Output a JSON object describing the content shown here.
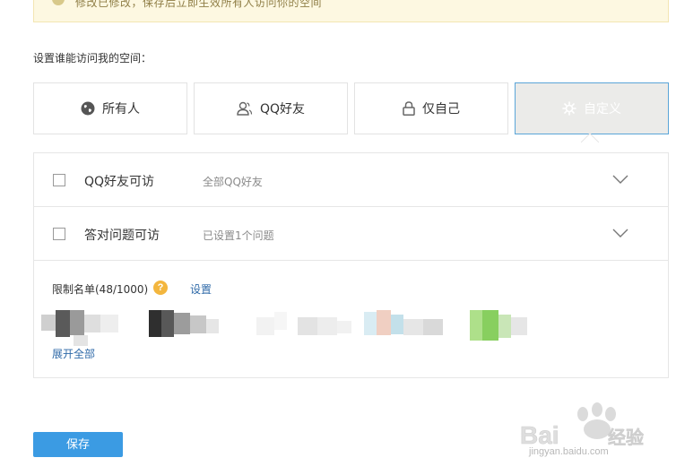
{
  "notice": {
    "text": "修改已修改，保存后立即生效所有人访问你的空间",
    "icon": "info-icon"
  },
  "section_label": "设置谁能访问我的空间：",
  "options": [
    {
      "label": "所有人",
      "icon": "globe-icon",
      "selected": false
    },
    {
      "label": "QQ好友",
      "icon": "friends-icon",
      "selected": false
    },
    {
      "label": "仅自己",
      "icon": "lock-icon",
      "selected": false
    },
    {
      "label": "自定义",
      "icon": "gear-icon",
      "selected": true
    }
  ],
  "rules": [
    {
      "title": "QQ好友可访",
      "desc": "全部QQ好友",
      "checked": false
    },
    {
      "title": "答对问题可访",
      "desc": "已设置1个问题",
      "checked": false
    }
  ],
  "limit": {
    "label": "限制名单(48/1000)",
    "help": "?",
    "setting_link": "设置",
    "expand_link": "展开全部"
  },
  "save_label": "保存",
  "watermark": {
    "brand": "Baidu经验",
    "url": "jingyan.baidu.com"
  },
  "colors": {
    "accent": "#3b9be3",
    "selected_border": "#5aa5d8",
    "link": "#2f6aa8",
    "help_badge": "#f3b63e",
    "notice_bg": "#fdf8e1"
  }
}
